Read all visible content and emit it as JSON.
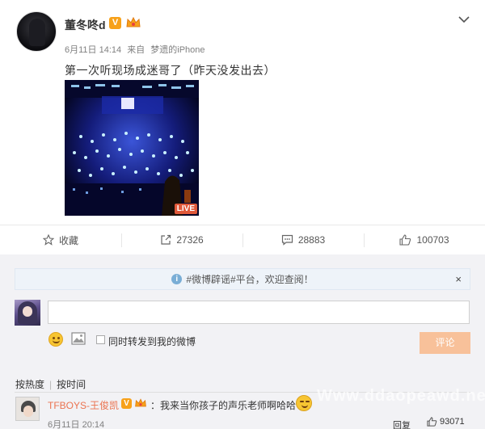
{
  "post": {
    "author": "董冬咚d",
    "verified_badge": "V",
    "date": "6月11日 14:14",
    "source_prefix": "来自",
    "source": "梦遗的iPhone",
    "text": "第一次听现场成迷哥了（昨天没发出去）",
    "photo_badge": "LIVE",
    "icons": {
      "more": "chevron-down-icon",
      "crown": "crown-icon"
    }
  },
  "actions": [
    {
      "label": "收藏",
      "icon": "star-icon"
    },
    {
      "label": "27326",
      "icon": "repost-icon"
    },
    {
      "label": "28883",
      "icon": "comment-icon"
    },
    {
      "label": "100703",
      "icon": "thumbs-up-icon"
    }
  ],
  "notice": {
    "text": "#微博辟谣#平台，欢迎查阅！",
    "close": "×"
  },
  "compose": {
    "input_value": "",
    "repost_label": "同时转发到我的微博",
    "submit_label": "评论"
  },
  "sort": {
    "hot": "按热度",
    "time": "按时间"
  },
  "comments": [
    {
      "author": "TFBOYS-王俊凯",
      "badge": "V",
      "text": "：我来当你孩子的声乐老师啊哈哈",
      "time": "6月11日 20:14",
      "reply_label": "回复",
      "likes": "93071"
    }
  ],
  "watermark": "Www.ddaopeawd.net",
  "colors": {
    "accent": "#eb7350",
    "submit_bg": "#f8c19a",
    "badge": "#f7a11a"
  }
}
